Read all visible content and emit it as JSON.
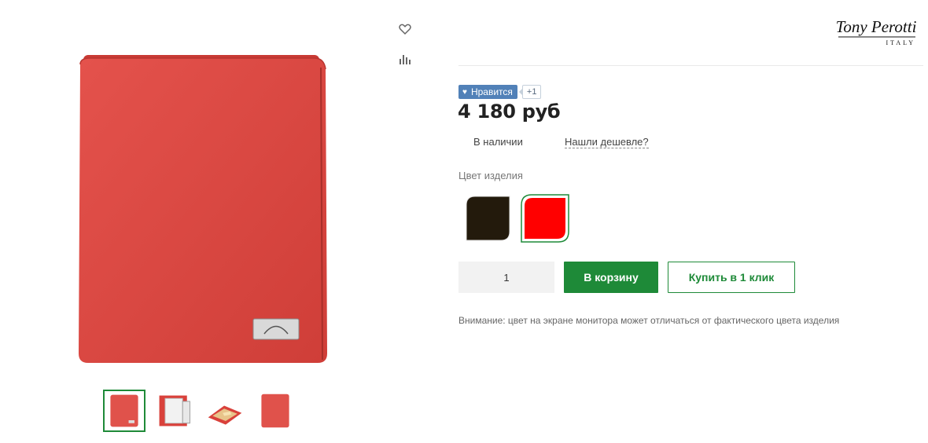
{
  "like": {
    "label": "Нравится",
    "count": "+1",
    "heart": "♥"
  },
  "price": "4 180 руб",
  "availability": "В наличии",
  "found_cheaper": "Нашли дешевле?",
  "color_label": "Цвет изделия",
  "colors": [
    {
      "name": "dark-brown",
      "hex": "#231a0c"
    },
    {
      "name": "red",
      "hex": "#ff0000",
      "selected": true
    }
  ],
  "quantity": "1",
  "buttons": {
    "add_to_cart": "В корзину",
    "buy_one_click": "Купить в 1 клик"
  },
  "note": "Внимание: цвет на экране монитора может отличаться от фактического цвета изделия",
  "brand": {
    "name": "Tony Perotti",
    "sub": "ITALY"
  },
  "icons": {
    "favorite": "heart-outline-icon",
    "compare": "bar-chart-icon"
  },
  "accent_color": "#1e8a38",
  "thumbnails": [
    "wallet-front",
    "wallet-open-cards",
    "wallet-open-angle",
    "wallet-back"
  ]
}
